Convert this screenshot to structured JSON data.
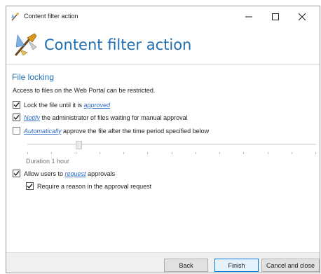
{
  "window": {
    "title": "Content filter action"
  },
  "header": {
    "title": "Content filter action"
  },
  "section": {
    "title": "File locking",
    "description": "Access to files on the Web Portal can be restricted."
  },
  "options": {
    "lock": {
      "checked": true,
      "text": "Lock the file until it is ",
      "link": "approved"
    },
    "notify": {
      "checked": true,
      "link": "Notify",
      "text": " the administrator of files waiting for manual approval"
    },
    "auto": {
      "checked": false,
      "link": "Automatically",
      "text": " approve the file after the time period specified below"
    },
    "allow": {
      "checked": true,
      "text": "Allow users to ",
      "link": "request",
      "text_after": " approvals"
    },
    "reason": {
      "checked": true,
      "text": "Require a reason in the approval request"
    }
  },
  "slider": {
    "value_fraction": 0.17,
    "tick_count": 13,
    "enabled": false
  },
  "duration": {
    "label": "Duration 1 hour"
  },
  "footer": {
    "back": "Back",
    "finish": "Finish",
    "cancel": "Cancel and close"
  },
  "colors": {
    "accent": "#1f6fb5",
    "link": "#2e6cc6",
    "disabled": "#777777"
  }
}
